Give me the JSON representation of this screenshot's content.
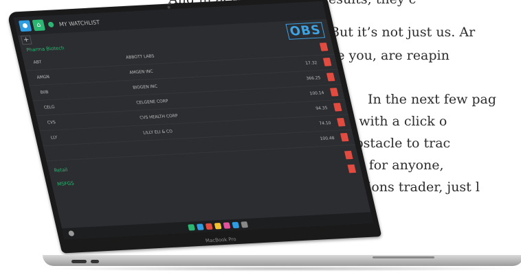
{
  "body_text": {
    "line0": "And in actual reported results, they c",
    "line1": "But it’s not just us. Ar",
    "line2": "just like you, are reapin",
    "line3": "In the next few pag",
    "line4": "how . . . with a click o",
    "line5": "every obstacle to trac",
    "line6": "possible for anyone,",
    "line7": "options trader, just l"
  },
  "laptop": {
    "brand": "MacBook Pro",
    "app": {
      "title": "MY WATCHLIST",
      "plus": "+",
      "logo": "OBS",
      "section1": "Pharma Biotech",
      "rows": [
        {
          "symbol": "ABT",
          "name": "ABBOTT LABS",
          "price": ""
        },
        {
          "symbol": "AMGN",
          "name": "AMGEN INC",
          "price": "17.32"
        },
        {
          "symbol": "BIIB",
          "name": "BIOGEN INC",
          "price": "366.25"
        },
        {
          "symbol": "CELG",
          "name": "CELGENE CORP",
          "price": "100.14"
        },
        {
          "symbol": "CVS",
          "name": "CVS HEALTH CORP",
          "price": "94.35"
        },
        {
          "symbol": "LLY",
          "name": "LILLY ELI & CO",
          "price": "74.10"
        },
        {
          "symbol": "",
          "name": "",
          "price": "100.48"
        }
      ],
      "section2": "Retail",
      "section3": "MSFGS"
    }
  },
  "colors": {
    "accent_green": "#2bb673",
    "accent_blue": "#2f9be0",
    "sell_red": "#e24b3f",
    "screen_bg": "#2b2d30"
  }
}
